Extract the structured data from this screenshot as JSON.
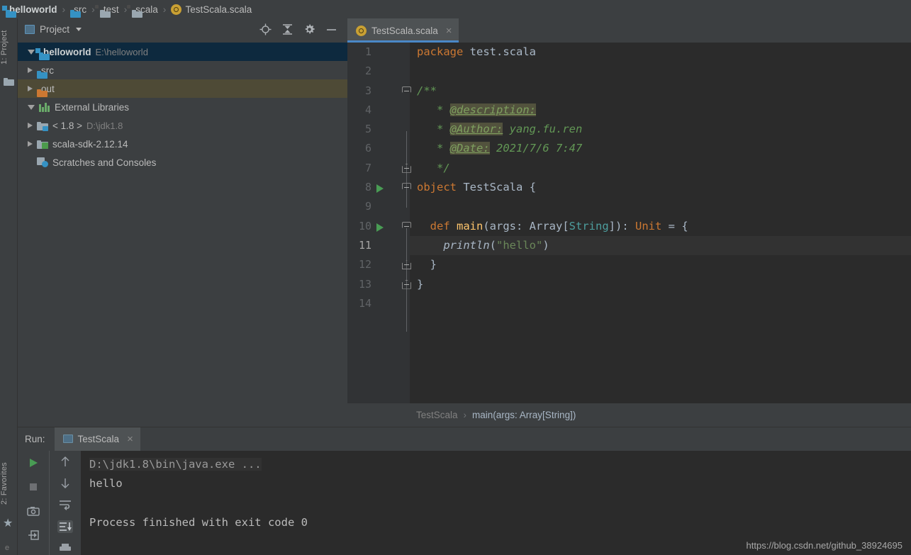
{
  "navbar": {
    "items": [
      {
        "label": "helloworld",
        "icon": "project-folder-icon",
        "bold": true
      },
      {
        "label": "src",
        "icon": "folder-blue-icon",
        "bold": false
      },
      {
        "label": "test",
        "icon": "folder-gray-icon",
        "bold": false
      },
      {
        "label": "scala",
        "icon": "folder-gray-icon",
        "bold": false
      },
      {
        "label": "TestScala.scala",
        "icon": "scala-object-icon",
        "bold": false
      }
    ],
    "separator": "›"
  },
  "leftbar": {
    "project_tab": "1: Project",
    "favorites_tab": "2: Favorites",
    "bottom_letter": "e"
  },
  "project_panel": {
    "title": "Project",
    "tools": [
      "locate-target-icon",
      "collapse-all-icon",
      "settings-gear-icon",
      "minimize-icon"
    ],
    "tree": [
      {
        "name": "helloworld",
        "path": "E:\\helloworld",
        "expanded": true,
        "state": "selected",
        "indent": 0,
        "icon": "project-folder-icon",
        "bold": true
      },
      {
        "name": "src",
        "path": "",
        "expanded": false,
        "state": "normal",
        "indent": 1,
        "icon": "folder-blue-icon",
        "bold": false
      },
      {
        "name": "out",
        "path": "",
        "expanded": false,
        "state": "highlighted",
        "indent": 1,
        "icon": "folder-orange-icon",
        "bold": false
      },
      {
        "name": "External Libraries",
        "path": "",
        "expanded": true,
        "state": "normal",
        "indent": 0,
        "icon": "libraries-icon",
        "bold": false
      },
      {
        "name": "< 1.8 >",
        "path": "D:\\jdk1.8",
        "expanded": false,
        "state": "normal",
        "indent": 1,
        "icon": "jdk-icon",
        "bold": false
      },
      {
        "name": "scala-sdk-2.12.14",
        "path": "",
        "expanded": false,
        "state": "normal",
        "indent": 1,
        "icon": "scala-sdk-icon",
        "bold": false
      },
      {
        "name": "Scratches and Consoles",
        "path": "",
        "expanded": null,
        "state": "normal",
        "indent": 0,
        "icon": "scratches-icon",
        "bold": false
      }
    ]
  },
  "editor": {
    "tab": {
      "label": "TestScala.scala",
      "icon": "scala-object-icon",
      "close": "×"
    },
    "lines": [
      {
        "n": "1",
        "run": false,
        "fold": "",
        "caret": false
      },
      {
        "n": "2",
        "run": false,
        "fold": "",
        "caret": false
      },
      {
        "n": "3",
        "run": false,
        "fold": "start",
        "caret": false
      },
      {
        "n": "4",
        "run": false,
        "fold": "",
        "caret": false
      },
      {
        "n": "5",
        "run": false,
        "fold": "",
        "caret": false
      },
      {
        "n": "6",
        "run": false,
        "fold": "",
        "caret": false
      },
      {
        "n": "7",
        "run": false,
        "fold": "end",
        "caret": false
      },
      {
        "n": "8",
        "run": true,
        "fold": "start",
        "caret": false
      },
      {
        "n": "9",
        "run": false,
        "fold": "",
        "caret": false
      },
      {
        "n": "10",
        "run": true,
        "fold": "start",
        "caret": false
      },
      {
        "n": "11",
        "run": false,
        "fold": "",
        "caret": true
      },
      {
        "n": "12",
        "run": false,
        "fold": "end",
        "caret": false
      },
      {
        "n": "13",
        "run": false,
        "fold": "end",
        "caret": false
      },
      {
        "n": "14",
        "run": false,
        "fold": "",
        "caret": false
      }
    ],
    "code_text": [
      "package test.scala",
      "",
      "/**",
      " * @description:",
      " * @Author: yang.fu.ren",
      " * @Date: 2021/7/6 7:47",
      " */",
      "object TestScala {",
      "",
      "  def main(args: Array[String]): Unit = {",
      "    println(\"hello\")",
      "  }",
      "}",
      ""
    ],
    "breadcrumbs": {
      "parent": "TestScala",
      "separator": "›",
      "current": "main(args: Array[String])"
    }
  },
  "run_panel": {
    "label": "Run:",
    "tab": {
      "label": "TestScala",
      "close": "×",
      "icon": "run-config-icon"
    },
    "toolbar_left": [
      "rerun-play-icon",
      "stop-square-icon",
      "dump-threads-camera-icon",
      "export-login-icon"
    ],
    "toolbar_right": [
      "up-arrow-icon",
      "down-arrow-icon",
      "soft-wrap-icon",
      "scroll-to-end-icon",
      "print-icon"
    ],
    "console": [
      {
        "text": "D:\\jdk1.8\\bin\\java.exe ...",
        "style": "dim-highlight"
      },
      {
        "text": "hello",
        "style": "normal"
      },
      {
        "text": "",
        "style": "normal"
      },
      {
        "text": "Process finished with exit code 0",
        "style": "normal"
      }
    ]
  },
  "watermark": "https://blog.csdn.net/github_38924695",
  "colors": {
    "panel_bg": "#3c3f41",
    "editor_bg": "#2b2b2b",
    "gutter_bg": "#313335",
    "selection_blue": "#0d293e",
    "highlight_olive": "#4e4a36",
    "tab_active": "#4e5254",
    "tab_underline": "#4a88c7",
    "keyword_orange": "#cc7832",
    "string_green": "#6a8759",
    "comment_green": "#629755",
    "type_teal": "#4d9e9e",
    "method_yellow": "#ffc66d",
    "text_default": "#a9b7c6",
    "run_green": "#499c54"
  }
}
